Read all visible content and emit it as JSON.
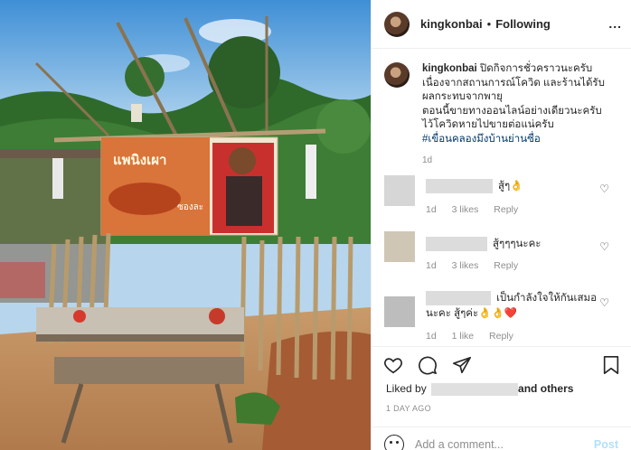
{
  "header": {
    "username": "kingkonbai",
    "separator": "•",
    "follow_status": "Following",
    "more_label": "..."
  },
  "caption": {
    "username": "kingkonbai",
    "lines": [
      "ปิดกิจการชั่วคราวนะครับ",
      "เนื่องจากสถานการณ์โควิด และร้านได้รับ",
      "ผลกระทบจากพายุ",
      "ตอนนี้ขายทางออนไลน์อย่างเดียวนะครับ",
      "ไว้โควิดหายไปขายต่อแน่ครับ"
    ],
    "hashtag": "#เขื่อนคลองมึงบ้านย่านซื่อ",
    "time": "1d"
  },
  "comments": [
    {
      "text": "สู้ๆ👌",
      "time": "1d",
      "likes": "3 likes",
      "reply": "Reply"
    },
    {
      "text": "สู้ๆๆๆนะคะ",
      "time": "1d",
      "likes": "3 likes",
      "reply": "Reply"
    },
    {
      "text_line1": "เป็นกำลังใจให้กันเสมอ",
      "text_line2": "นะคะ สู้ๆค่ะ👌👌❤️",
      "time": "1d",
      "likes": "1 like",
      "reply": "Reply"
    }
  ],
  "likes": {
    "prefix": "Liked by",
    "suffix_and": "and",
    "suffix_others": "others"
  },
  "time_ago": "1 DAY AGO",
  "add_comment": {
    "placeholder": "Add a comment...",
    "post_label": "Post"
  },
  "sign": {
    "text": "แพนิงเผา",
    "subtext": "ซองละ"
  },
  "icons": [
    "heart-icon",
    "comment-icon",
    "share-icon",
    "bookmark-icon",
    "emoji-icon",
    "more-icon"
  ],
  "colors": {
    "hashtag": "#00376b",
    "meta": "#8e8e8e",
    "post_disabled": "#b2dffc",
    "divider": "#efefef"
  }
}
